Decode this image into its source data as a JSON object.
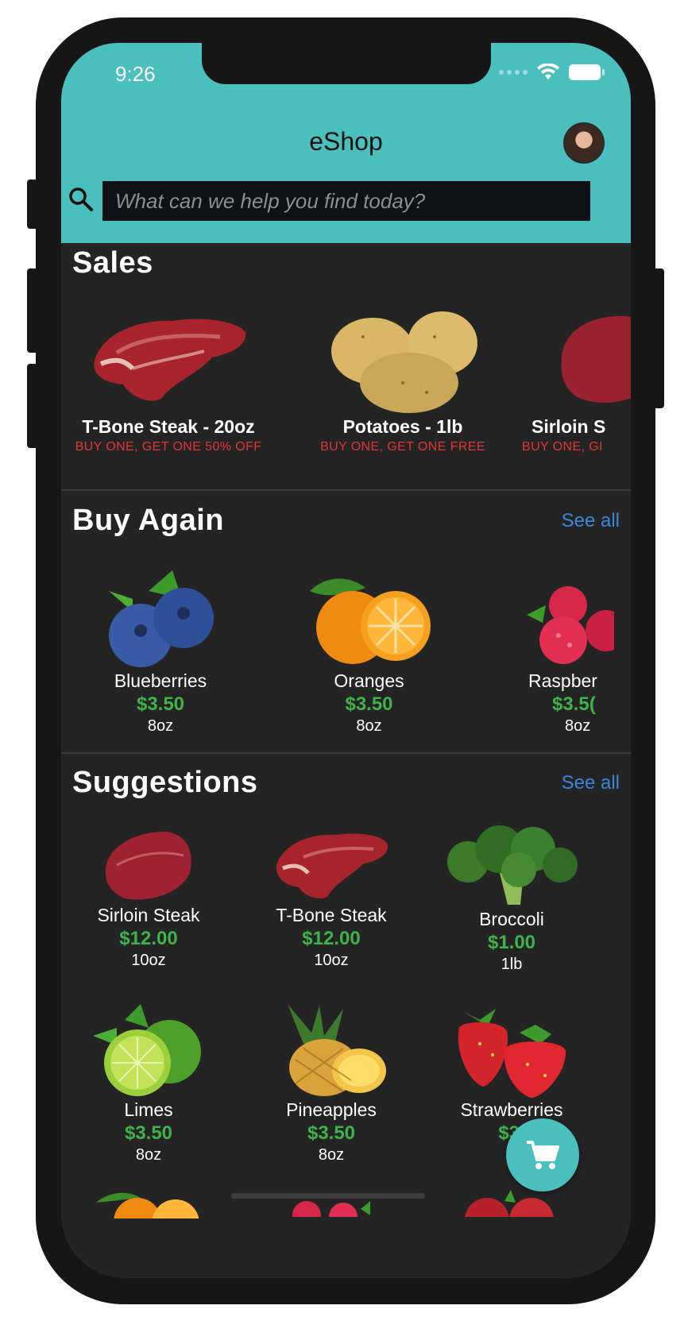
{
  "status_bar": {
    "time": "9:26"
  },
  "header": {
    "title": "eShop"
  },
  "search": {
    "placeholder": "What can we help you find today?"
  },
  "sales": {
    "title": "Sales",
    "items": [
      {
        "name": "T-Bone Steak - 20oz",
        "promo": "BUY ONE, GET ONE 50% OFF",
        "icon": "steak-icon"
      },
      {
        "name": "Potatoes - 1lb",
        "promo": "BUY ONE, GET ONE FREE",
        "icon": "potatoes-icon"
      },
      {
        "name": "Sirloin S",
        "promo": "BUY ONE, GI",
        "icon": "sirloin-icon"
      }
    ]
  },
  "buy_again": {
    "title": "Buy Again",
    "see_all": "See all",
    "items": [
      {
        "name": "Blueberries",
        "price": "$3.50",
        "size": "8oz"
      },
      {
        "name": "Oranges",
        "price": "$3.50",
        "size": "8oz"
      },
      {
        "name": "Raspber",
        "price": "$3.5(",
        "size": "8oz"
      }
    ]
  },
  "suggestions": {
    "title": "Suggestions",
    "see_all": "See all",
    "items": [
      {
        "name": "Sirloin Steak",
        "price": "$12.00",
        "size": "10oz"
      },
      {
        "name": "T-Bone Steak",
        "price": "$12.00",
        "size": "10oz"
      },
      {
        "name": "Broccoli",
        "price": "$1.00",
        "size": "1lb"
      },
      {
        "name": "Limes",
        "price": "$3.50",
        "size": "8oz"
      },
      {
        "name": "Pineapples",
        "price": "$3.50",
        "size": "8oz"
      },
      {
        "name": "Strawberries",
        "price": "$3.",
        "size": "8"
      }
    ]
  },
  "colors": {
    "accent": "#4bbfbe",
    "price": "#3fb24a",
    "promo": "#e23636",
    "link": "#3a86d8",
    "background": "#242424"
  },
  "icons": [
    "search-icon",
    "wifi-icon",
    "battery-icon",
    "cart-icon",
    "avatar"
  ]
}
